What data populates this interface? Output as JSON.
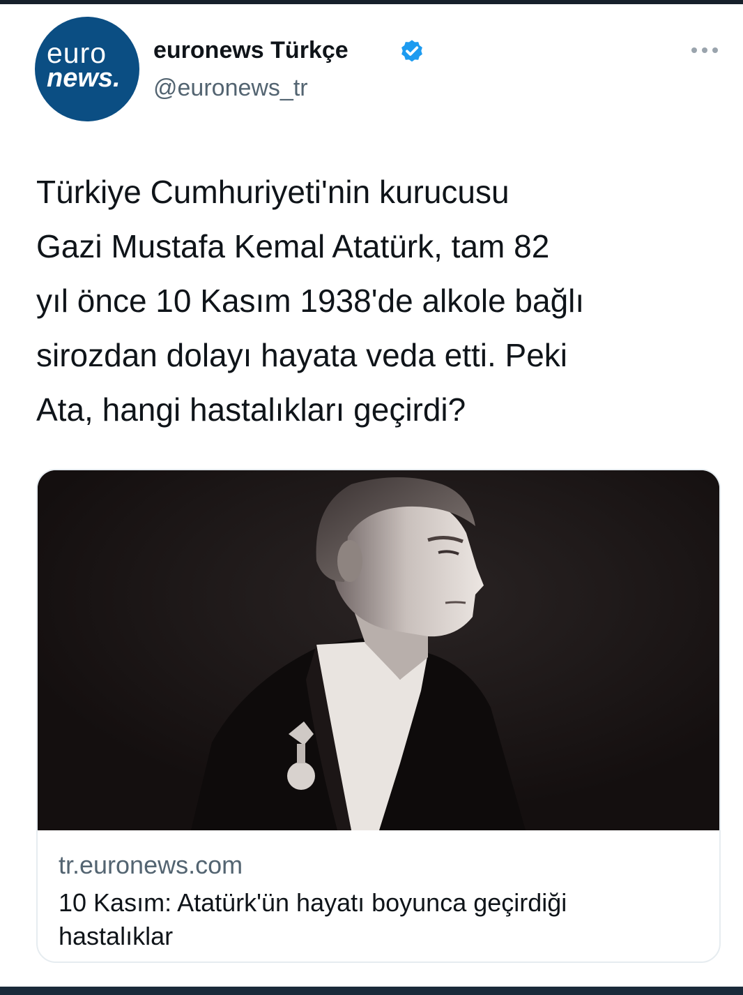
{
  "tweet": {
    "avatar": {
      "line1": "euro",
      "line2": "news."
    },
    "display_name": "euronews Türkçe",
    "handle": "@euronews_tr",
    "verified_icon": "verified-badge-icon",
    "more_icon": "more-horizontal-icon",
    "text_lines": [
      "Türkiye Cumhuriyeti'nin kurucusu",
      "Gazi Mustafa Kemal Atatürk, tam 82",
      "yıl önce 10 Kasım 1938'de alkole bağlı",
      "sirozdan dolayı hayata veda etti. Peki",
      "Ata, hangi hastalıkları geçirdi?"
    ],
    "link_card": {
      "domain": "tr.euronews.com",
      "title_lines": [
        "10 Kasım: Atatürk'ün hayatı boyunca geçirdiği",
        "hastalıklar"
      ],
      "image": "black-and-white-portrait-photo"
    }
  },
  "colors": {
    "brand_blue": "#0b4e83",
    "verified_blue": "#1d9bf0",
    "secondary_text": "#536471",
    "primary_text": "#0f1419",
    "card_border": "#e6ecf0"
  }
}
